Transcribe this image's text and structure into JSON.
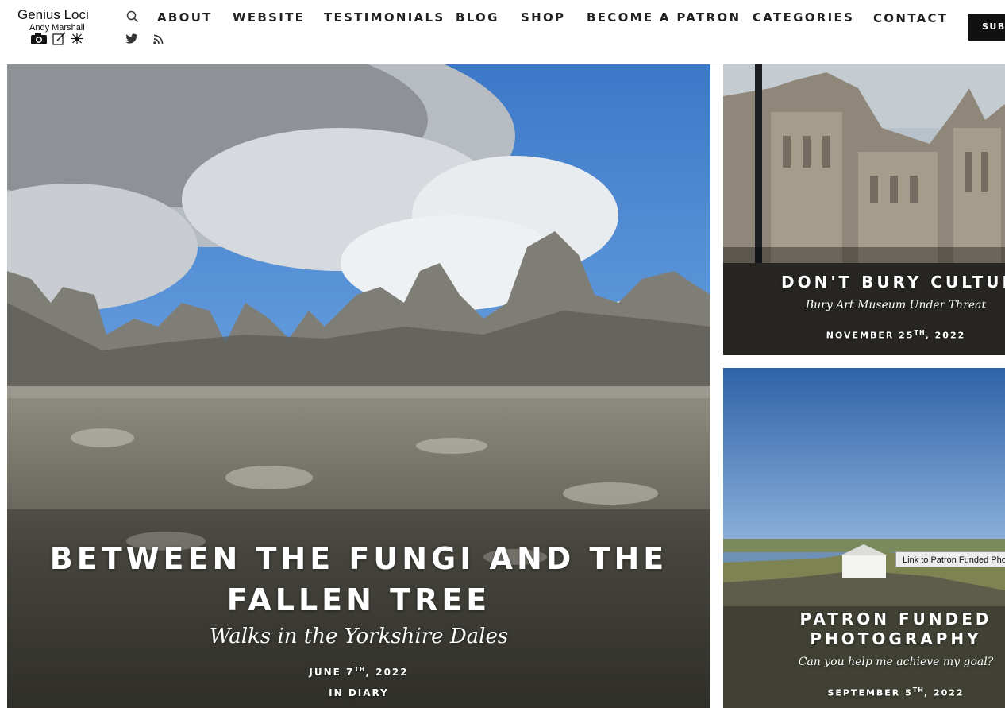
{
  "brand": {
    "name": "Genius Loci",
    "author": "Andy Marshall"
  },
  "nav": {
    "items": [
      "ABOUT",
      "WEBSITE",
      "TESTIMONIALS",
      "BLOG",
      "SHOP",
      "BECOME A PATRON",
      "CATEGORIES",
      "CONTACT"
    ],
    "subscribe_label": "SUBSCRIBE"
  },
  "posts": {
    "featured": {
      "title_line1": "BETWEEN THE FUNGI AND THE",
      "title_line2": "FALLEN TREE",
      "subtitle": "Walks in the Yorkshire Dales",
      "date_prefix": "JUNE 7",
      "date_suffix": "TH",
      "date_year": ", 2022",
      "category_prefix": "IN",
      "category": "DIARY"
    },
    "side1": {
      "title": "DON'T BURY CULTURE",
      "subtitle": "Bury Art Museum Under Threat",
      "date_prefix": "NOVEMBER 25",
      "date_suffix": "TH",
      "date_year": ", 2022"
    },
    "side2": {
      "title_line1": "PATRON FUNDED",
      "title_line2": "PHOTOGRAPHY",
      "subtitle": "Can you help me achieve my goal?",
      "date_prefix": "SEPTEMBER 5",
      "date_suffix": "TH",
      "date_year": ", 2022",
      "tooltip": "Link to Patron Funded Photography"
    }
  },
  "icons": [
    "camera-icon",
    "edit-icon",
    "sparkle-icon",
    "search-icon",
    "twitter-icon",
    "rss-icon"
  ]
}
